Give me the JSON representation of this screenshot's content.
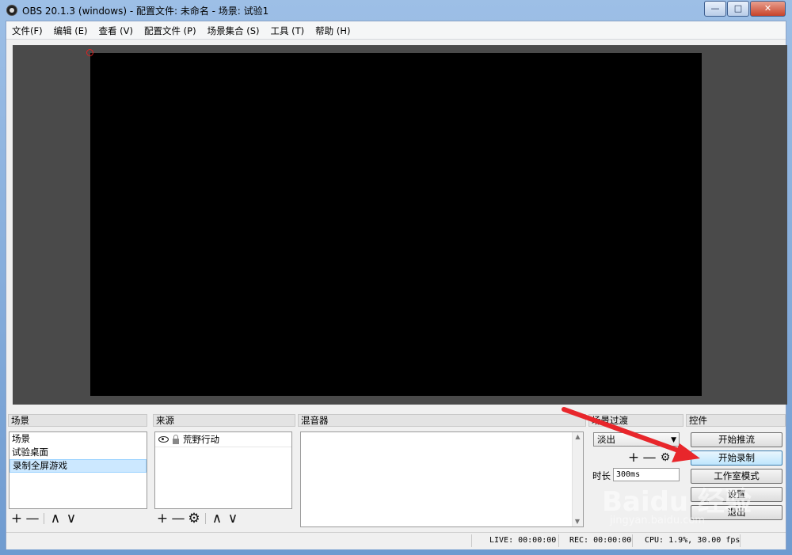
{
  "window": {
    "title": "OBS 20.1.3 (windows) - 配置文件: 未命名 - 场景: 试验1",
    "minimize": "—",
    "maximize": "□",
    "close": "✕"
  },
  "menu": [
    "文件(F)",
    "编辑 (E)",
    "查看 (V)",
    "配置文件 (P)",
    "场景集合 (S)",
    "工具 (T)",
    "帮助 (H)"
  ],
  "docks": {
    "scenes_title": "场景",
    "sources_title": "来源",
    "mixer_title": "混音器",
    "transitions_title": "场景过渡",
    "controls_title": "控件"
  },
  "scenes": {
    "items": [
      "场景",
      "试验桌面",
      "录制全屏游戏"
    ],
    "selected_index": 2
  },
  "sources": {
    "items": [
      {
        "name": "荒野行动",
        "visible": true,
        "locked": false
      }
    ]
  },
  "transitions": {
    "selected": "淡出",
    "duration_label": "时长",
    "duration_value": "300ms"
  },
  "controls": {
    "start_stream": "开始推流",
    "start_record": "开始录制",
    "studio_mode": "工作室模式",
    "settings": "设置",
    "exit": "退出"
  },
  "toolbar_icons": {
    "add": "+",
    "remove": "—",
    "up": "∧",
    "down": "∨",
    "gear": "⚙"
  },
  "status": {
    "live": "LIVE: 00:00:00",
    "rec": "REC: 00:00:00",
    "cpu": "CPU: 1.9%, 30.00 fps"
  },
  "watermark": {
    "main": "Baidu 经验",
    "sub": "jingyan.baidu.com"
  },
  "colors": {
    "preview_bg": "#4a4a4a",
    "canvas": "#000000",
    "annotation_arrow": "#e8262b",
    "selected_row": "#cce8ff"
  }
}
